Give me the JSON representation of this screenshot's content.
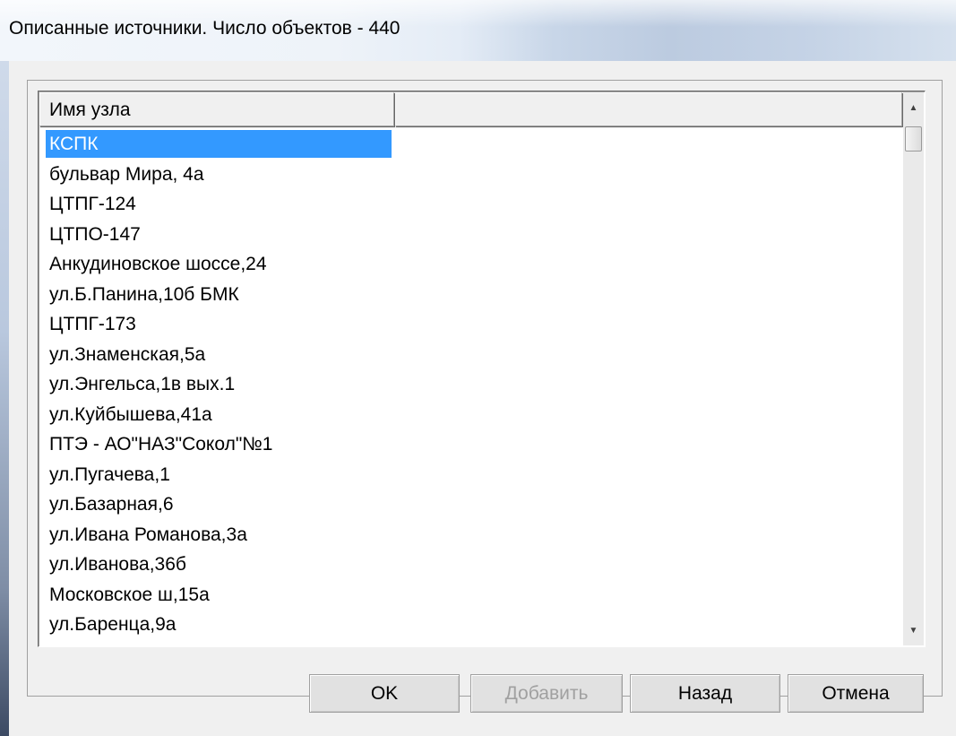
{
  "window": {
    "title": "Описанные источники. Число объектов - 440"
  },
  "list": {
    "columns": [
      {
        "label": "Имя узла"
      },
      {
        "label": ""
      }
    ],
    "rows": [
      "КСПК",
      "бульвар Мира, 4а",
      "ЦТПГ-124",
      "ЦТПО-147",
      "Анкудиновское шоссе,24",
      "ул.Б.Панина,10б БМК",
      "ЦТПГ-173",
      "ул.Знаменская,5а",
      "ул.Энгельса,1в вых.1",
      "ул.Куйбышева,41а",
      "ПТЭ - АО\"НАЗ\"Сокол\"№1",
      "ул.Пугачева,1",
      "ул.Базарная,6",
      "ул.Ивана Романова,3а",
      "ул.Иванова,36б",
      "Московское ш,15а",
      "ул.Баренца,9а"
    ],
    "selected_index": 0,
    "scroll_up_icon": "triangle-up",
    "scroll_down_icon": "triangle-down"
  },
  "buttons": {
    "ok": "OK",
    "add": "Добавить",
    "back": "Назад",
    "cancel": "Отмена"
  },
  "colors": {
    "selection": "#3399ff",
    "disabled_text": "#a0a0a0"
  }
}
